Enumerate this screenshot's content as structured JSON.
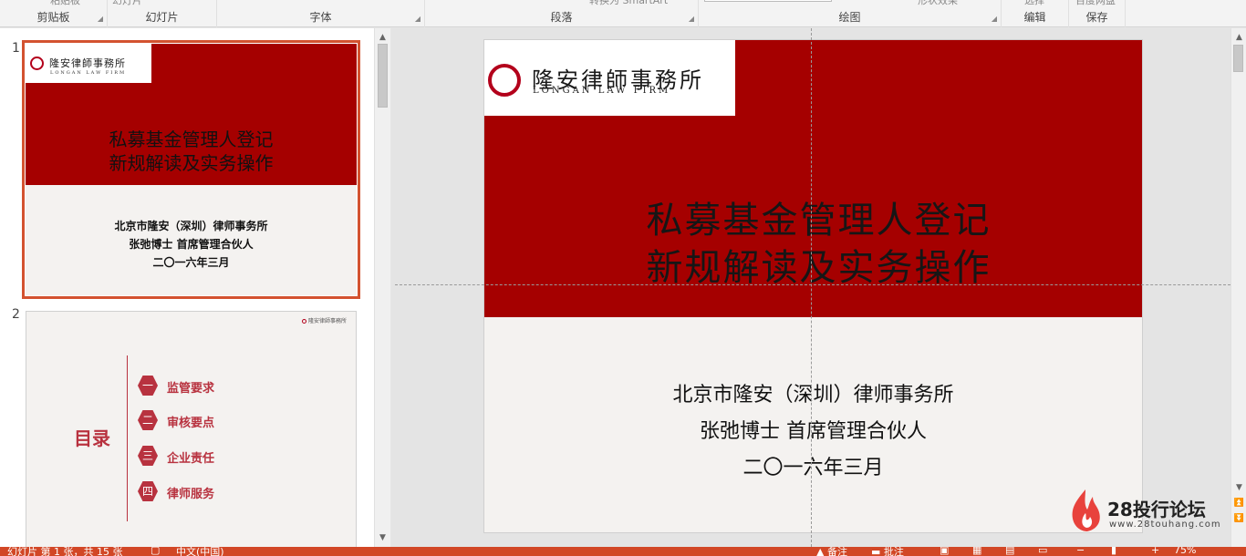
{
  "ribbon": {
    "groups": [
      {
        "label": "剪贴板",
        "top": "粘贴板"
      },
      {
        "label": "幻灯片",
        "top": "幻灯片"
      },
      {
        "label": "字体",
        "top": ""
      },
      {
        "label": "段落",
        "top": "转换为 SmartArt"
      },
      {
        "label": "绘图",
        "top": "形状效果"
      },
      {
        "label": "编辑",
        "top": "选择"
      },
      {
        "label": "保存",
        "top": "百度网盘"
      }
    ]
  },
  "thumbnails": {
    "slide1": {
      "number": "1",
      "logo_cn": "隆安律師事務所",
      "logo_en": "LONGAN LAW FIRM",
      "title_line1": "私募基金管理人登记",
      "title_line2": "新规解读及实务操作",
      "org": "北京市隆安（深圳）律师事务所",
      "person": "张弛博士  首席管理合伙人",
      "date": "二〇一六年三月"
    },
    "slide2": {
      "number": "2",
      "logo_small": "隆安律師事務所",
      "heading": "目录",
      "items": [
        {
          "badge": "一",
          "label": "监管要求"
        },
        {
          "badge": "二",
          "label": "审核要点"
        },
        {
          "badge": "三",
          "label": "企业责任"
        },
        {
          "badge": "四",
          "label": "律师服务"
        }
      ]
    }
  },
  "slide": {
    "logo_cn": "隆安律師事務所",
    "logo_en": "LONGAN  LAW  FIRM",
    "title_line1": "私募基金管理人登记",
    "title_line2": "新规解读及实务操作",
    "org": "北京市隆安（深圳）律师事务所",
    "person": "张弛博士  首席管理合伙人",
    "date": "二〇一六年三月"
  },
  "statusbar": {
    "slide_info": "幻灯片 第 1 张，共 15 张",
    "language": "中文(中国)",
    "notes": "备注",
    "comments": "批注",
    "zoom": "75%"
  },
  "watermark": {
    "title": "28投行论坛",
    "url": "www.28touhang.com"
  },
  "colors": {
    "accent": "#d24726",
    "slide_red": "#a50000",
    "badge_red": "#b8323f"
  }
}
